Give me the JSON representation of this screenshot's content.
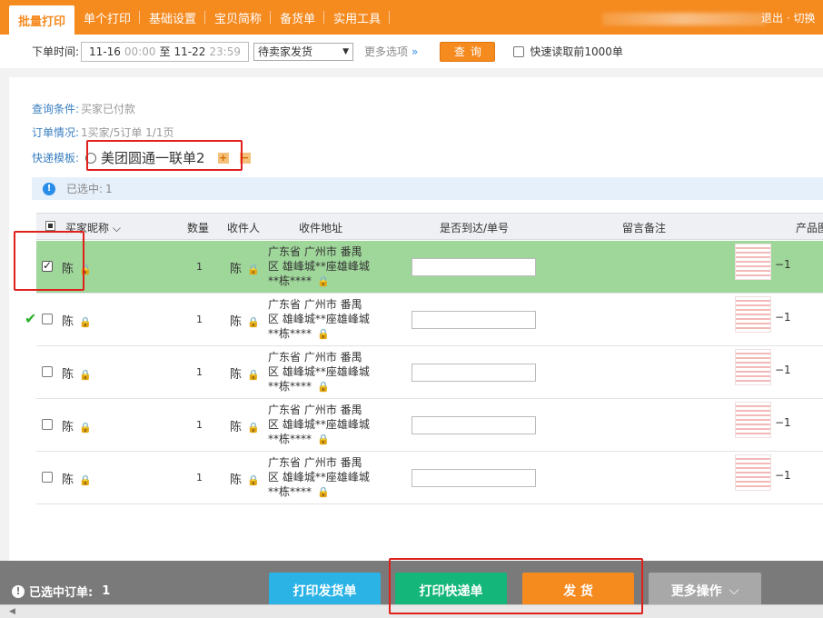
{
  "nav": {
    "tabs": [
      "批量打印",
      "单个打印",
      "基础设置",
      "宝贝简称",
      "备货单",
      "实用工具"
    ],
    "logout": "退出 · 切换"
  },
  "filter": {
    "label": "下单时间:",
    "start_date": "11-16",
    "start_time": "00:00",
    "to": "至",
    "end_date": "11-22",
    "end_time": "23:59",
    "status_value": "待卖家发货",
    "more_options": "更多选项",
    "more_chev": "»",
    "query": "查询",
    "quick_read": "快速读取前1000单"
  },
  "conditions": {
    "query_label": "查询条件:",
    "query_value": "买家已付款",
    "orders_label": "订单情况:",
    "orders_value": "1买家/5订单   1/1页",
    "template_label": "快递模板:",
    "template_name": "美团圆通一联单2",
    "add": "+",
    "remove": "−",
    "selected_label": "已选中:",
    "selected_value": "1"
  },
  "table": {
    "headers": {
      "buyer": "买家昵称",
      "qty": "数量",
      "receiver": "收件人",
      "address": "收件地址",
      "tracking": "是否到达/单号",
      "note": "留言备注",
      "product": "产品图"
    },
    "rows": [
      {
        "nick": "陈",
        "qty": "1",
        "receiver": "陈",
        "addr1": "广东省 广州市 番禺",
        "addr2": "区 雄峰城**座雄峰城",
        "addr3": "**栋****",
        "pqty": "−1",
        "checked": true
      },
      {
        "nick": "陈",
        "qty": "1",
        "receiver": "陈",
        "addr1": "广东省 广州市 番禺",
        "addr2": "区 雄峰城**座雄峰城",
        "addr3": "**栋****",
        "pqty": "−1",
        "checked": false
      },
      {
        "nick": "陈",
        "qty": "1",
        "receiver": "陈",
        "addr1": "广东省 广州市 番禺",
        "addr2": "区 雄峰城**座雄峰城",
        "addr3": "**栋****",
        "pqty": "−1",
        "checked": false
      },
      {
        "nick": "陈",
        "qty": "1",
        "receiver": "陈",
        "addr1": "广东省 广州市 番禺",
        "addr2": "区 雄峰城**座雄峰城",
        "addr3": "**栋****",
        "pqty": "−1",
        "checked": false
      },
      {
        "nick": "陈",
        "qty": "1",
        "receiver": "陈",
        "addr1": "广东省 广州市 番禺",
        "addr2": "区 雄峰城**座雄峰城",
        "addr3": "**栋****",
        "pqty": "−1",
        "checked": false
      }
    ]
  },
  "bottom": {
    "selected_label": "已选中订单:",
    "selected_value": "1",
    "print_invoice": "打印发货单",
    "print_express": "打印快递单",
    "ship": "发  货",
    "more_ops": "更多操作"
  },
  "colors": {
    "brand": "#f58a1f",
    "selected_row": "#9fd69a",
    "btn_invoice": "#2bb3e6",
    "btn_express": "#15b67a",
    "btn_ship": "#f58a1f",
    "btn_more": "#a8a8a8",
    "highlight": "#e0201b"
  },
  "icons": {
    "lock": "lock-icon",
    "info": "info-icon",
    "check": "check-icon"
  }
}
